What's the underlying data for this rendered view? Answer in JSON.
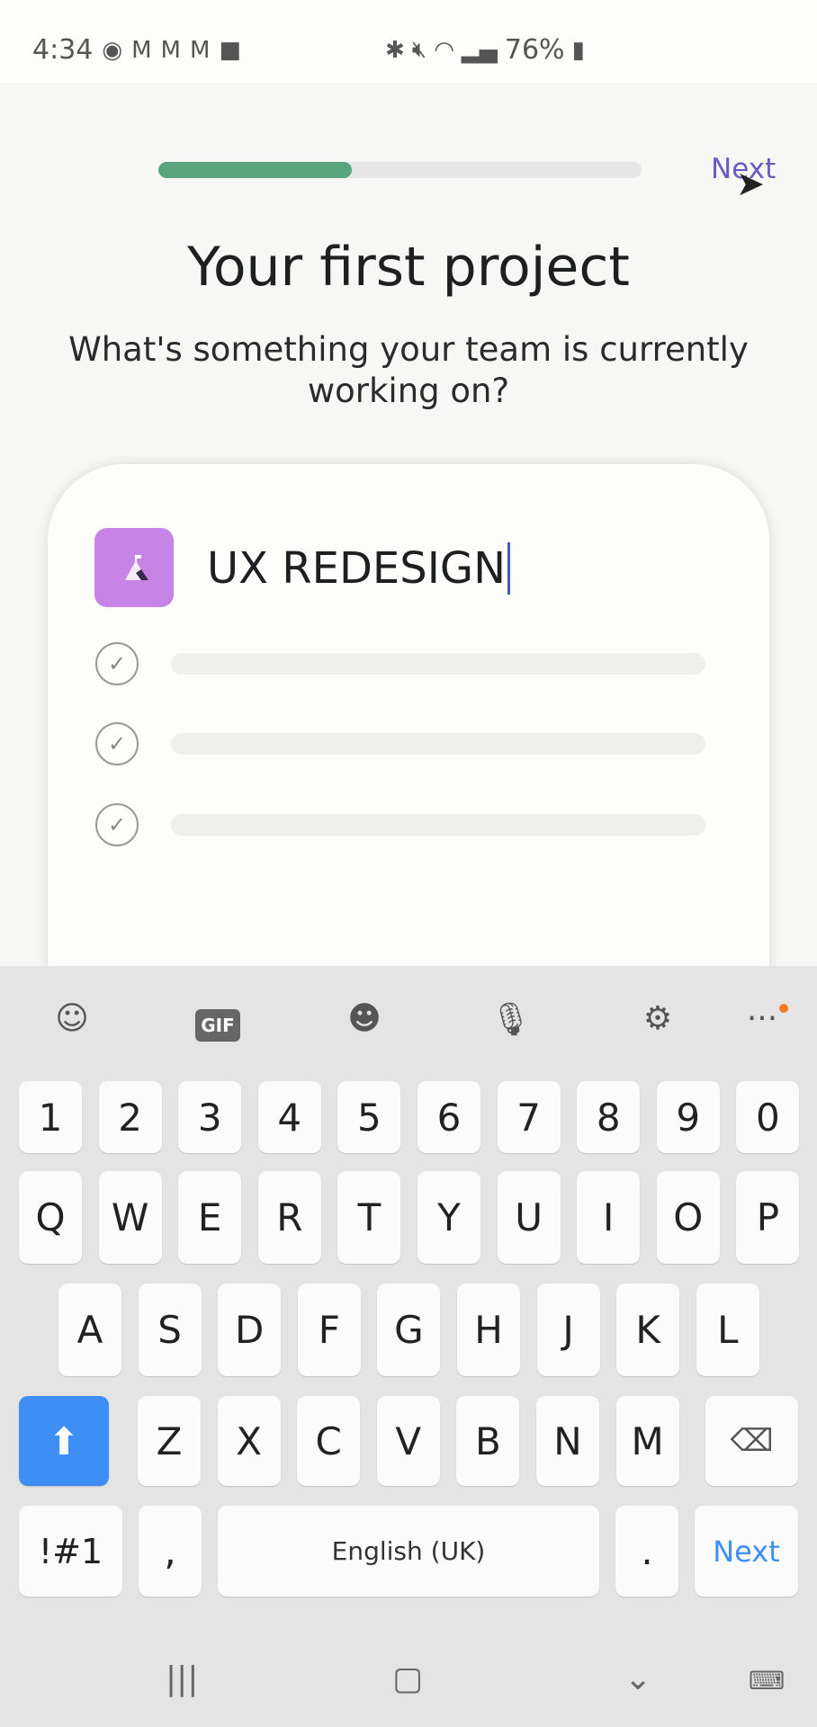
{
  "status_bar": {
    "time": "4:34",
    "battery": "76%",
    "icons": [
      "messenger-icon",
      "gmail-icon",
      "gmail-icon",
      "gmail-icon",
      "video-icon",
      "bluetooth-icon",
      "mute-icon",
      "wifi-icon",
      "signal-icon",
      "battery-icon"
    ]
  },
  "header": {
    "progress_percent": 40,
    "next_label": "Next",
    "progress_color": "#58a57c"
  },
  "main": {
    "title": "Your first project",
    "subtitle": "What's something your team is currently working on?",
    "project_name": "UX REDESIGN",
    "icon_color": "#c584e6"
  },
  "keyboard": {
    "toolbar": [
      "sticker-icon",
      "gif-icon",
      "emoji-icon",
      "microphone-icon",
      "settings-icon",
      "more-icon"
    ],
    "gif_label": "GIF",
    "row_numbers": [
      "1",
      "2",
      "3",
      "4",
      "5",
      "6",
      "7",
      "8",
      "9",
      "0"
    ],
    "row_1": [
      "Q",
      "W",
      "E",
      "R",
      "T",
      "Y",
      "U",
      "I",
      "O",
      "P"
    ],
    "row_2": [
      "A",
      "S",
      "D",
      "F",
      "G",
      "H",
      "J",
      "K",
      "L"
    ],
    "row_3": [
      "Z",
      "X",
      "C",
      "V",
      "B",
      "N",
      "M"
    ],
    "symbols_label": "!#1",
    "comma": ",",
    "space_label": "English (UK)",
    "period": ".",
    "next_label": "Next",
    "accent_color": "#3d8ef5"
  }
}
